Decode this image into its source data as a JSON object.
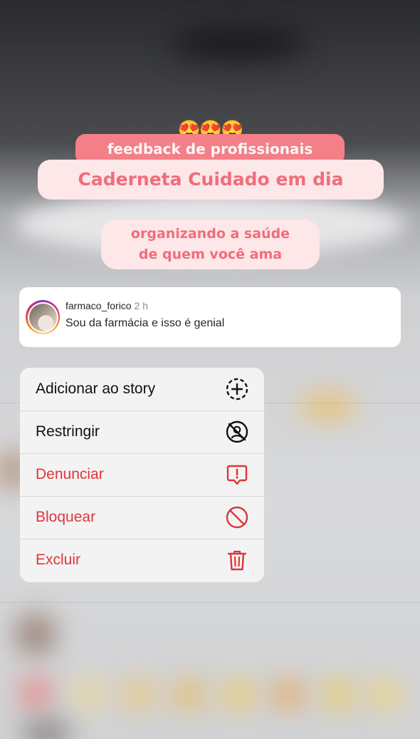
{
  "story": {
    "emoji": "😍😍😍",
    "pill_top": "feedback de profissionais",
    "pill_title": "Caderneta Cuidado em dia",
    "pill_sub_line1": "organizando a saúde",
    "pill_sub_line2": "de quem você ama"
  },
  "comment": {
    "username": "farmaco_forico",
    "time": "2 h",
    "text": "Sou da farmácia e isso é genial"
  },
  "menu": {
    "items": [
      {
        "label": "Adicionar ao story",
        "icon": "add-circle-dashed-icon",
        "color": "#111111"
      },
      {
        "label": "Restringir",
        "icon": "restrict-icon",
        "color": "#111111"
      },
      {
        "label": "Denunciar",
        "icon": "report-icon",
        "color": "#e0353a"
      },
      {
        "label": "Bloquear",
        "icon": "block-icon",
        "color": "#e0353a"
      },
      {
        "label": "Excluir",
        "icon": "trash-icon",
        "color": "#e0353a"
      }
    ]
  },
  "colors": {
    "pill_accent": "#f37f88",
    "pill_light": "#fde7e8",
    "pill_text": "#f06d7b",
    "destructive": "#e0353a"
  }
}
